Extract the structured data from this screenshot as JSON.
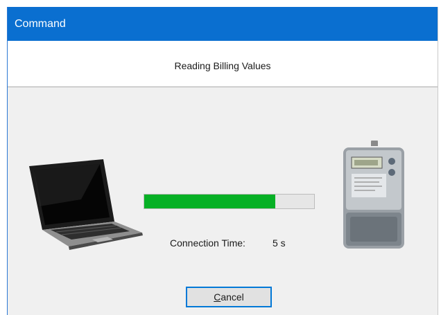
{
  "window": {
    "title": "Command"
  },
  "header": {
    "text": "Reading Billing Values"
  },
  "progress": {
    "fraction": 0.77,
    "color": "#06b025"
  },
  "connection": {
    "label": "Connection Time:",
    "value": "5 s"
  },
  "buttons": {
    "cancel_accel": "C",
    "cancel_rest": "ancel"
  },
  "icons": {
    "source": "laptop-icon",
    "target": "electricity-meter-icon"
  },
  "colors": {
    "titlebar": "#0a6fd0",
    "progress_fill": "#06b025",
    "button_focus_border": "#0078d7"
  }
}
